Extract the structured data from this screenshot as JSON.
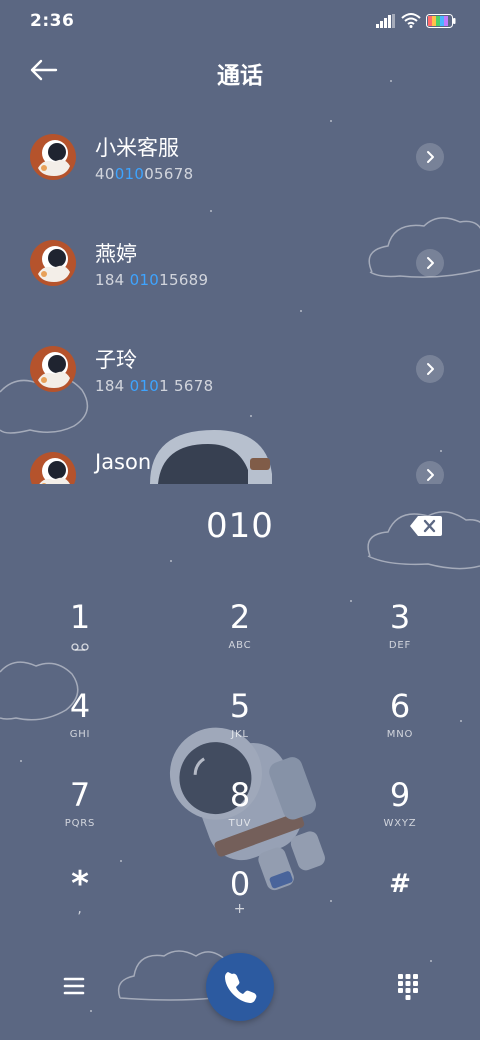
{
  "status_bar": {
    "time": "2:36"
  },
  "header": {
    "title": "通话"
  },
  "contacts": [
    {
      "name": "小米客服",
      "number_pre": "40",
      "number_match": "010",
      "number_post": "05678"
    },
    {
      "name": "燕婷",
      "number_pre": "184 ",
      "number_match": "010",
      "number_post": "15689"
    },
    {
      "name": "子玲",
      "number_pre": "184 ",
      "number_match": "010",
      "number_post": "1 5678"
    },
    {
      "name": "Jason",
      "number_pre": "",
      "number_match": "",
      "number_post": ""
    }
  ],
  "dialer": {
    "input": "010"
  },
  "keypad": {
    "keys": [
      {
        "digit": "1",
        "letters": ""
      },
      {
        "digit": "2",
        "letters": "ABC"
      },
      {
        "digit": "3",
        "letters": "DEF"
      },
      {
        "digit": "4",
        "letters": "GHI"
      },
      {
        "digit": "5",
        "letters": "JKL"
      },
      {
        "digit": "6",
        "letters": "MNO"
      },
      {
        "digit": "7",
        "letters": "PQRS"
      },
      {
        "digit": "8",
        "letters": "TUV"
      },
      {
        "digit": "9",
        "letters": "WXYZ"
      },
      {
        "digit": "*",
        "letters": ","
      },
      {
        "digit": "0",
        "letters": "+"
      },
      {
        "digit": "#",
        "letters": ""
      }
    ]
  },
  "icons": {
    "back": "arrow-left-icon",
    "detail": "chevron-right-icon",
    "backspace": "backspace-icon",
    "voicemail": "voicemail-icon",
    "menu": "menu-icon",
    "call": "phone-icon",
    "keypad_toggle": "dialpad-icon"
  },
  "colors": {
    "background": "#5b6782",
    "match_highlight": "#3ea4ff",
    "call_button": "#2c5aa0",
    "text": "#ffffff"
  }
}
